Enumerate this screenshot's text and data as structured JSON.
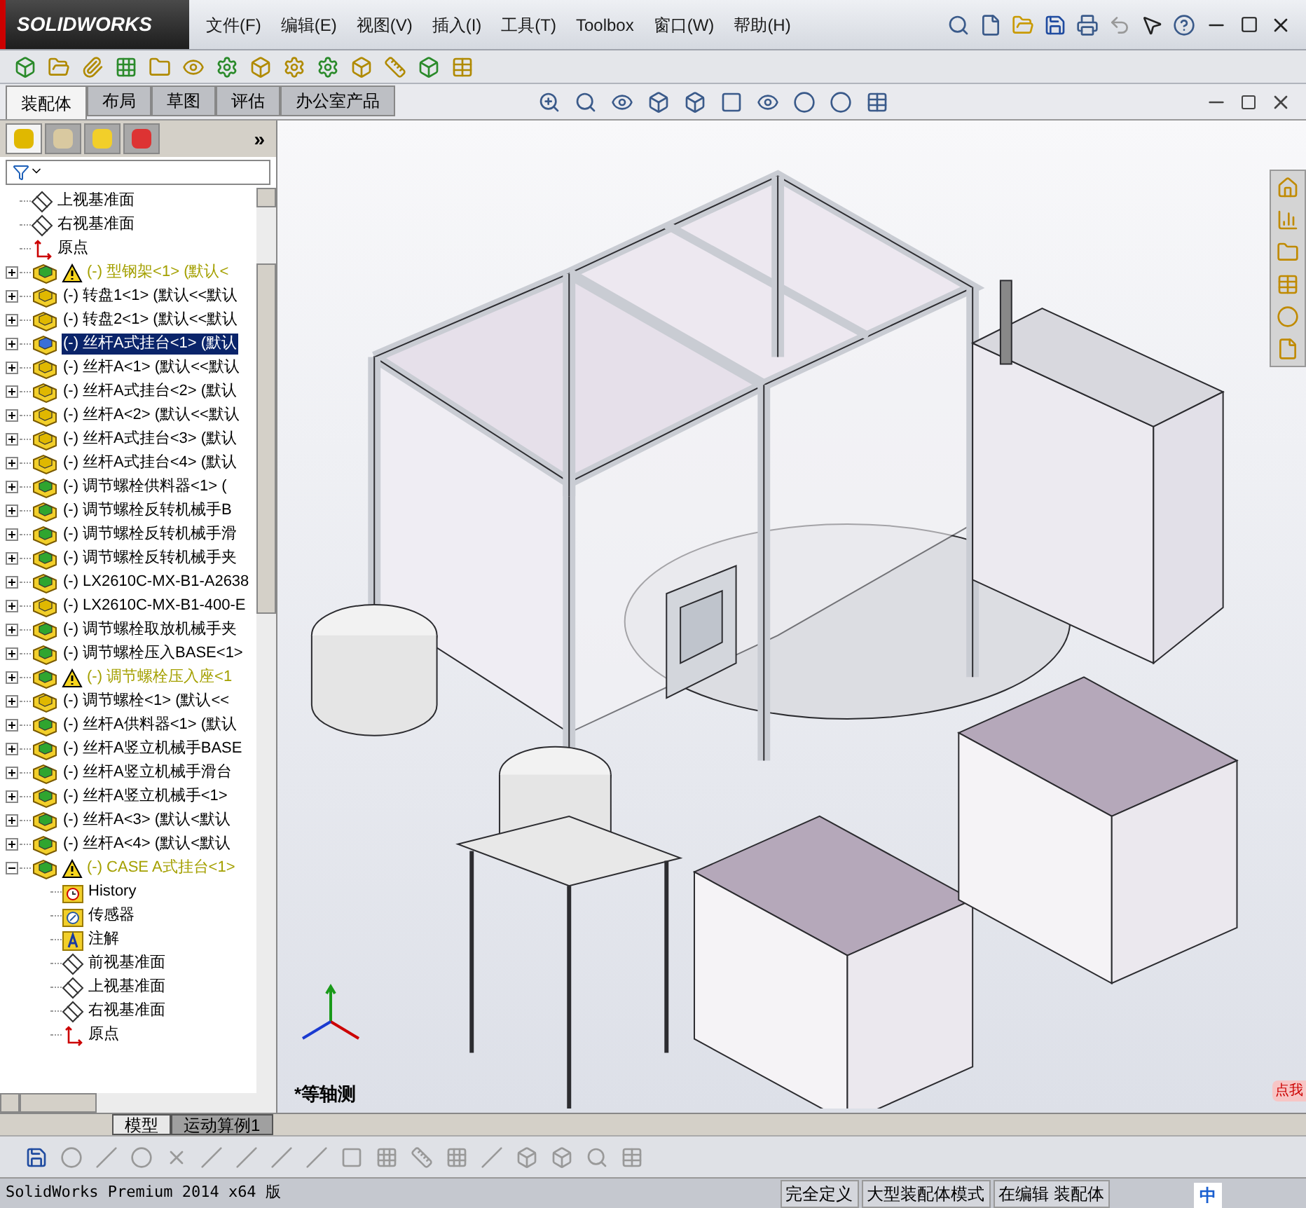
{
  "app": {
    "logo": "SOLIDWORKS",
    "menu": [
      "文件(F)",
      "编辑(E)",
      "视图(V)",
      "插入(I)",
      "工具(T)",
      "Toolbox",
      "窗口(W)",
      "帮助(H)"
    ]
  },
  "command_tabs": [
    {
      "label": "装配体",
      "selected": true
    },
    {
      "label": "布局",
      "selected": false
    },
    {
      "label": "草图",
      "selected": false
    },
    {
      "label": "评估",
      "selected": false
    },
    {
      "label": "办公室产品",
      "selected": false
    }
  ],
  "panel_tabs": [
    {
      "kind": "tree",
      "selected": true
    },
    {
      "kind": "property",
      "selected": false
    },
    {
      "kind": "config",
      "selected": false
    },
    {
      "kind": "display",
      "selected": false
    }
  ],
  "panel_more": "»",
  "tree": [
    {
      "kind": "plane",
      "label": "上视基准面"
    },
    {
      "kind": "plane",
      "label": "右视基准面"
    },
    {
      "kind": "origin",
      "label": "原点"
    },
    {
      "kind": "green",
      "label": "(-) 型钢架<1> (默认<",
      "warning": true,
      "expanded": false,
      "selected": false
    },
    {
      "kind": "yellow",
      "label": "(-) 转盘1<1> (默认<<默认",
      "expanded": false,
      "selected": false
    },
    {
      "kind": "yellow",
      "label": "(-) 转盘2<1> (默认<<默认",
      "expanded": false,
      "selected": false
    },
    {
      "kind": "blue",
      "label": "(-) 丝杆A式挂台<1> (默认",
      "expanded": false,
      "selected": true
    },
    {
      "kind": "yellow",
      "label": "(-) 丝杆A<1> (默认<<默认",
      "expanded": false,
      "selected": false
    },
    {
      "kind": "yellow",
      "label": "(-) 丝杆A式挂台<2> (默认",
      "expanded": false,
      "selected": false
    },
    {
      "kind": "yellow",
      "label": "(-) 丝杆A<2> (默认<<默认",
      "expanded": false,
      "selected": false
    },
    {
      "kind": "yellow",
      "label": "(-) 丝杆A式挂台<3> (默认",
      "expanded": false,
      "selected": false
    },
    {
      "kind": "yellow",
      "label": "(-) 丝杆A式挂台<4> (默认",
      "expanded": false,
      "selected": false
    },
    {
      "kind": "green",
      "label": "(-) 调节螺栓供料器<1> (",
      "expanded": false,
      "selected": false
    },
    {
      "kind": "green",
      "label": "(-) 调节螺栓反转机械手B",
      "expanded": false,
      "selected": false
    },
    {
      "kind": "green",
      "label": "(-) 调节螺栓反转机械手滑",
      "expanded": false,
      "selected": false
    },
    {
      "kind": "green",
      "label": "(-) 调节螺栓反转机械手夹",
      "expanded": false,
      "selected": false
    },
    {
      "kind": "green",
      "label": "(-) LX2610C-MX-B1-A2638",
      "expanded": false,
      "selected": false
    },
    {
      "kind": "yellow",
      "label": "(-) LX2610C-MX-B1-400-E",
      "expanded": false,
      "selected": false
    },
    {
      "kind": "green",
      "label": "(-) 调节螺栓取放机械手夹",
      "expanded": false,
      "selected": false
    },
    {
      "kind": "green",
      "label": "(-) 调节螺栓压入BASE<1>",
      "expanded": false,
      "selected": false
    },
    {
      "kind": "green",
      "label": "(-) 调节螺栓压入座<1",
      "warning": true,
      "expanded": false,
      "selected": false
    },
    {
      "kind": "yellow",
      "label": "(-) 调节螺栓<1> (默认<<",
      "expanded": false,
      "selected": false
    },
    {
      "kind": "green",
      "label": "(-) 丝杆A供料器<1> (默认",
      "expanded": false,
      "selected": false
    },
    {
      "kind": "green",
      "label": "(-) 丝杆A竖立机械手BASE",
      "expanded": false,
      "selected": false
    },
    {
      "kind": "green",
      "label": "(-) 丝杆A竖立机械手滑台",
      "expanded": false,
      "selected": false
    },
    {
      "kind": "green",
      "label": "(-) 丝杆A竖立机械手<1>",
      "expanded": false,
      "selected": false
    },
    {
      "kind": "green",
      "label": "(-) 丝杆A<3> (默认<默认",
      "expanded": false,
      "selected": false
    },
    {
      "kind": "green",
      "label": "(-) 丝杆A<4> (默认<默认",
      "expanded": false,
      "selected": false
    },
    {
      "kind": "green",
      "label": "(-) CASE A式挂台<1>",
      "warning": true,
      "expanded": true,
      "selected": false,
      "children": [
        {
          "kind": "history",
          "label": "History"
        },
        {
          "kind": "sensor",
          "label": "传感器"
        },
        {
          "kind": "annotation",
          "label": "注解"
        },
        {
          "kind": "plane",
          "label": "前视基准面"
        },
        {
          "kind": "plane",
          "label": "上视基准面"
        },
        {
          "kind": "plane",
          "label": "右视基准面"
        },
        {
          "kind": "origin",
          "label": "原点"
        }
      ]
    }
  ],
  "model_tabs": [
    {
      "label": "模型",
      "selected": true
    },
    {
      "label": "运动算例1",
      "selected": false
    }
  ],
  "viewport": {
    "view_label": "*等轴测"
  },
  "ad_badge": "点我",
  "status_bar": {
    "product": "SolidWorks Premium 2014 x64 版",
    "fields": [
      "完全定义",
      "大型装配体模式",
      "在编辑 装配体"
    ],
    "ime": "中"
  }
}
